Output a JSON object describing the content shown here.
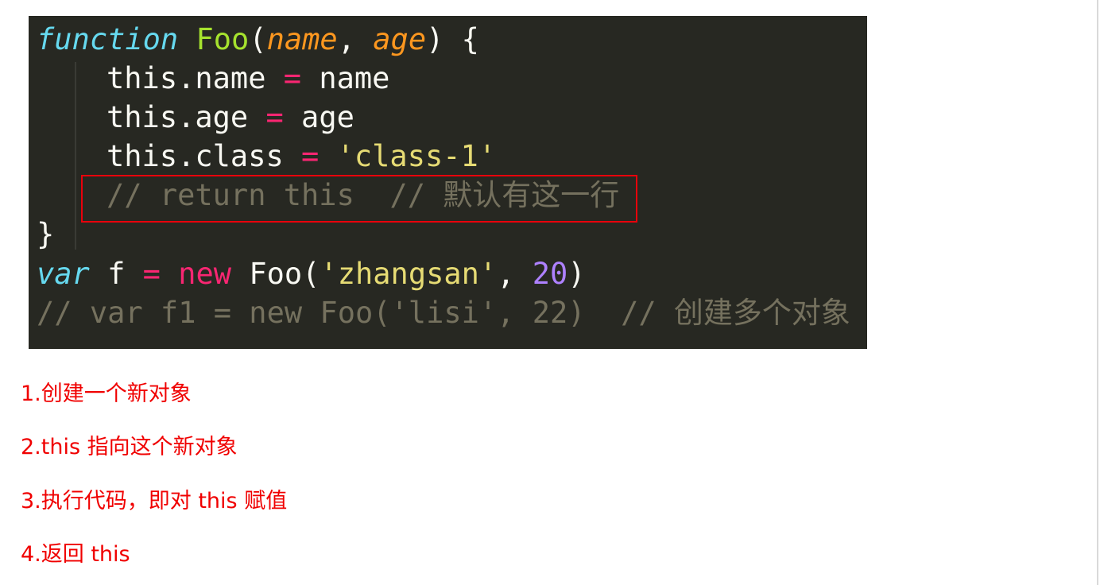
{
  "code": {
    "line1": {
      "kw": "function",
      "fn": "Foo",
      "open": "(",
      "p1": "name",
      "comma": ", ",
      "p2": "age",
      "close": ") {"
    },
    "line2": {
      "lhs": "this.name ",
      "op": "=",
      "rhs": " name"
    },
    "line3": {
      "lhs": "this.age ",
      "op": "=",
      "rhs": " age"
    },
    "line4": {
      "lhs": "this.class ",
      "op": "=",
      "sp": " ",
      "str": "'class-1'"
    },
    "line5": {
      "comment": "// return this  // 默认有这一行"
    },
    "line6": {
      "brace": "}"
    },
    "line7": {
      "kw": "var",
      "sp": " f ",
      "op1": "=",
      "sp2": " ",
      "op2": "new",
      "fn": " Foo(",
      "str": "'zhangsan'",
      "comma": ", ",
      "num": "20",
      "close": ")"
    },
    "line8": {
      "comment": "// var f1 = new Foo('lisi', 22)  // 创建多个对象"
    }
  },
  "steps": [
    "1.创建一个新对象",
    "2.this 指向这个新对象",
    "3.执行代码，即对 this 赋值",
    "4.返回 this"
  ],
  "colors": {
    "code_background": "#272822",
    "highlight_box": "#e8000b",
    "step_text": "#f00000"
  }
}
